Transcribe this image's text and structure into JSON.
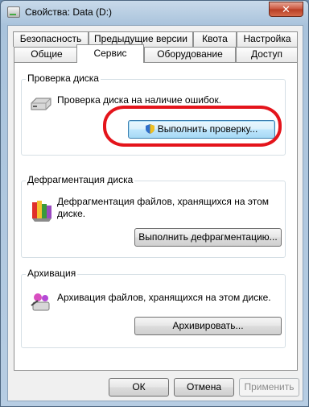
{
  "window": {
    "title": "Свойства: Data (D:)",
    "close_glyph": "✕"
  },
  "tabs": {
    "row_top": [
      "Безопасность",
      "Предыдущие версии",
      "Квота",
      "Настройка"
    ],
    "row_bottom": [
      "Общие",
      "Сервис",
      "Оборудование",
      "Доступ"
    ],
    "active": "Сервис"
  },
  "groups": {
    "check": {
      "title": "Проверка диска",
      "description": "Проверка диска на наличие ошибок.",
      "button": "Выполнить проверку..."
    },
    "defrag": {
      "title": "Дефрагментация диска",
      "description_line1": "Дефрагментация файлов, хранящихся на этом",
      "description_line2": "диске.",
      "button": "Выполнить дефрагментацию..."
    },
    "backup": {
      "title": "Архивация",
      "description": "Архивация файлов, хранящихся на этом диске.",
      "button": "Архивировать..."
    }
  },
  "footer": {
    "ok": "ОК",
    "cancel": "Отмена",
    "apply": "Применить"
  },
  "icons": {
    "drive": "hard-drive-icon",
    "defrag": "defrag-icon",
    "backup": "backup-icon",
    "shield": "uac-shield-icon"
  },
  "colors": {
    "highlight_ring": "#e4141b",
    "focus_border": "#3c7fb1"
  }
}
